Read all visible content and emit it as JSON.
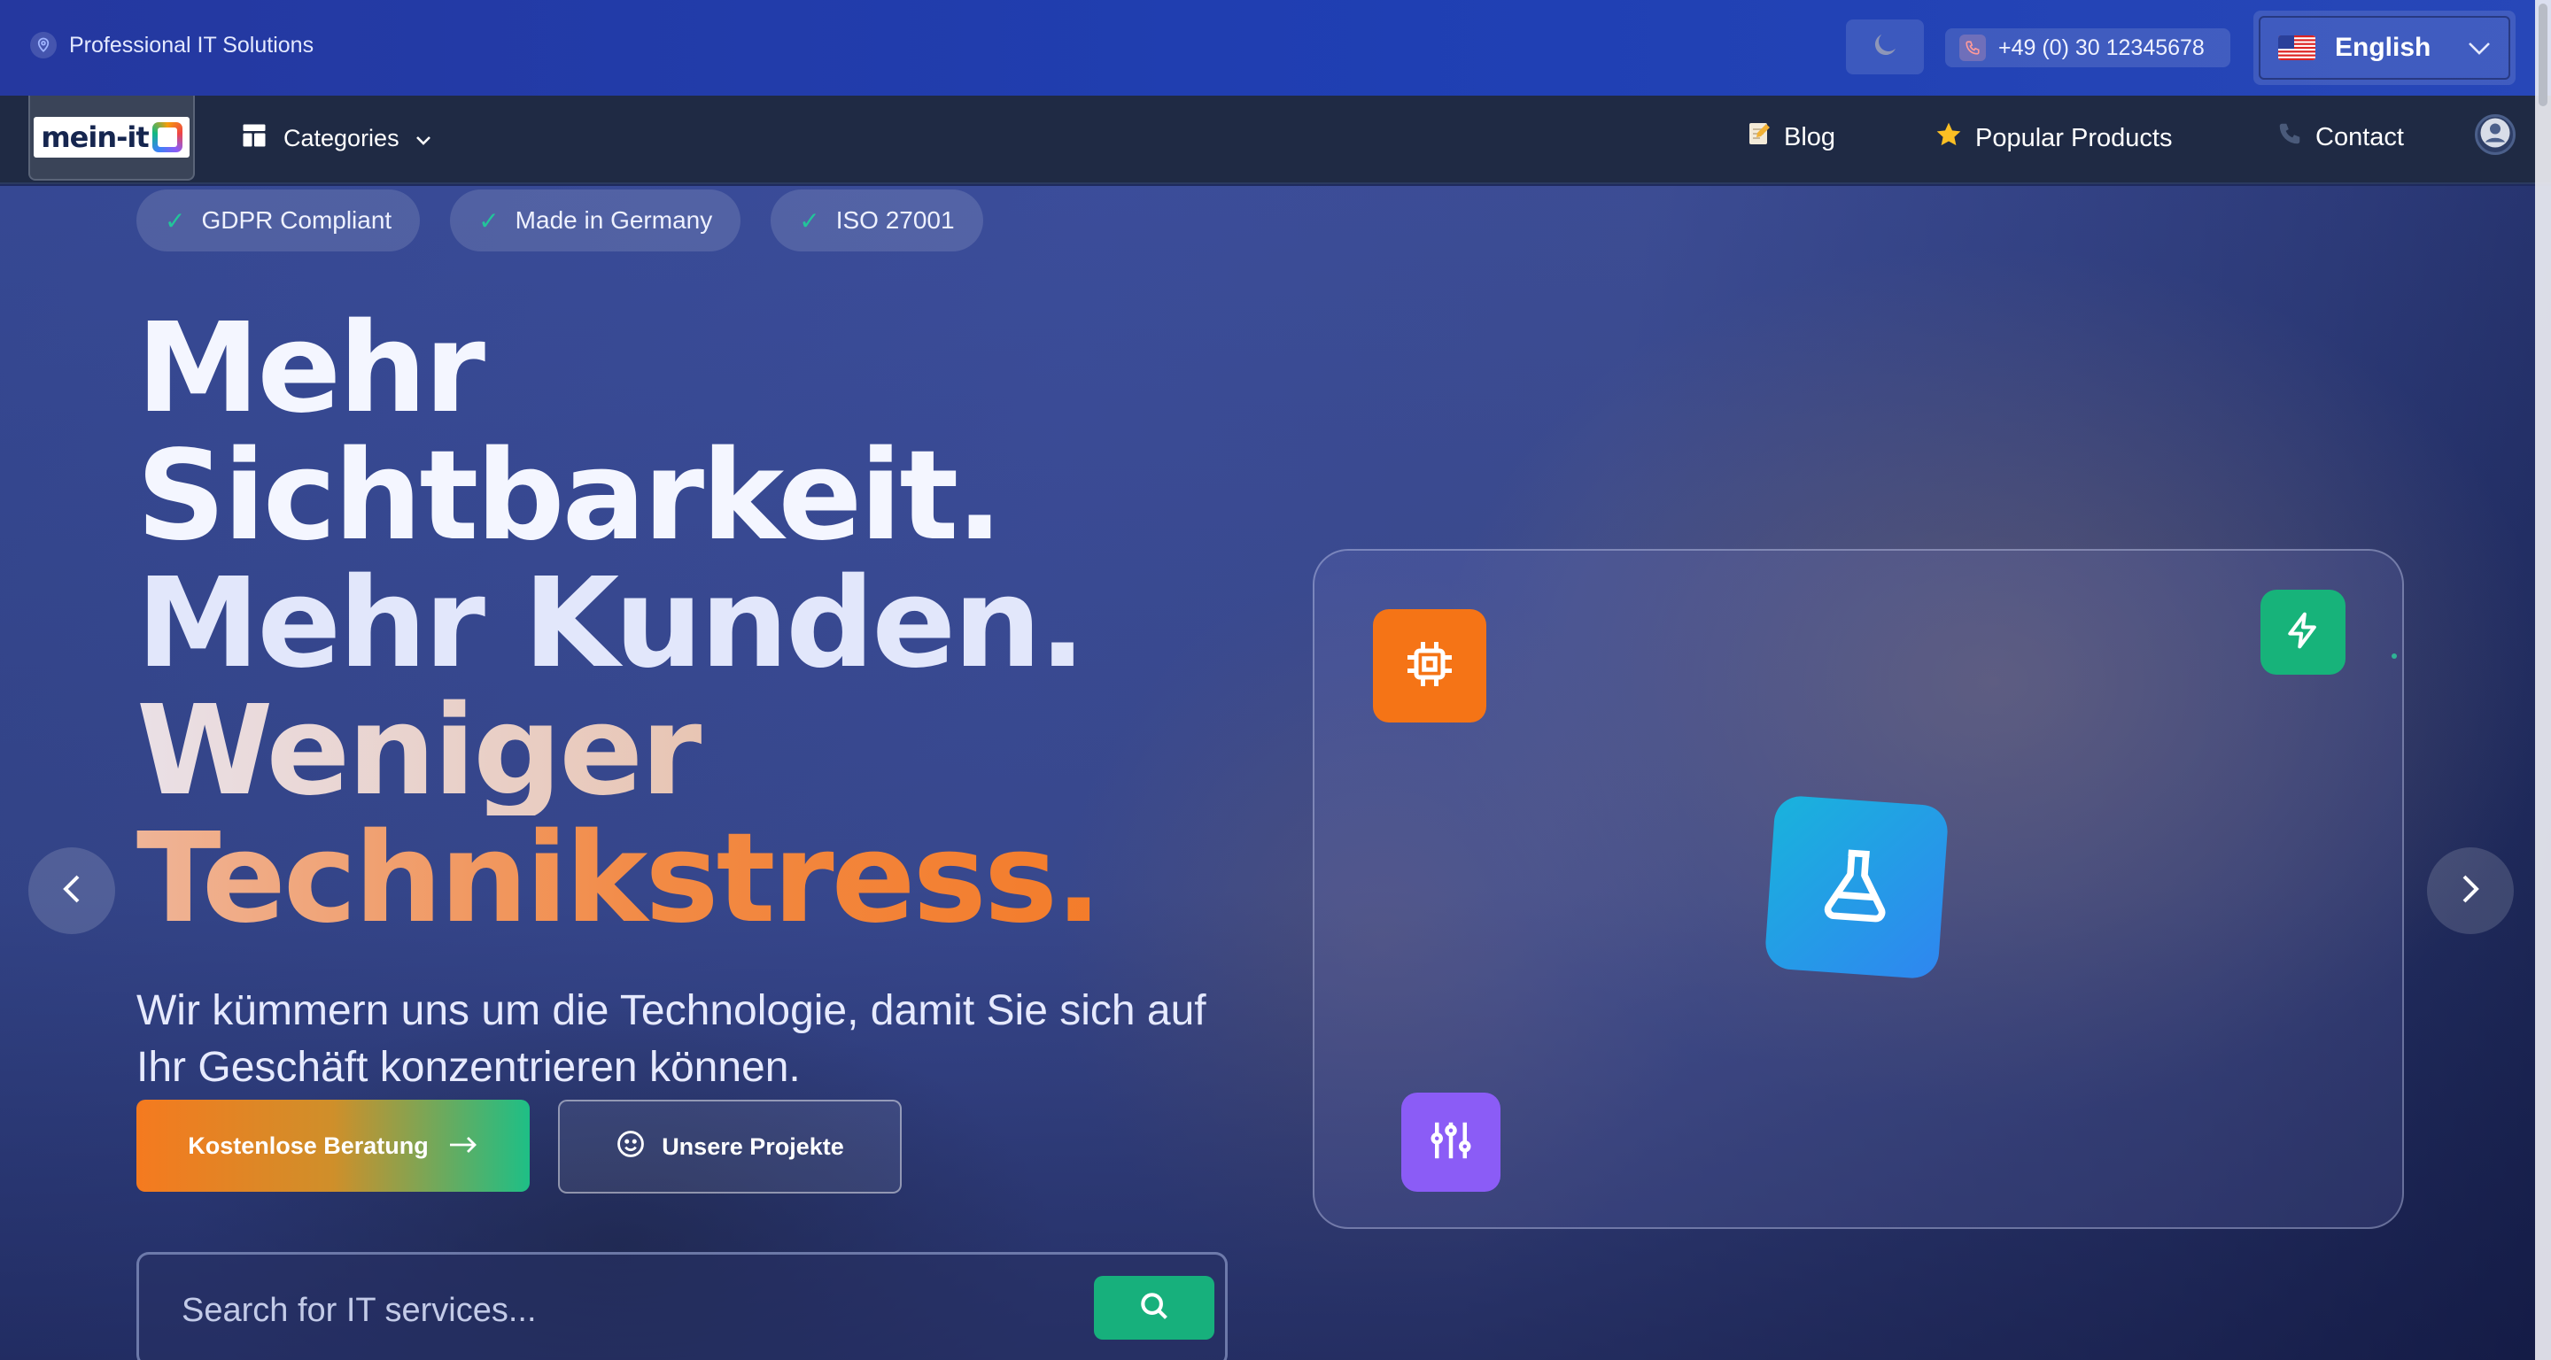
{
  "topbar": {
    "tagline": "Professional IT Solutions",
    "phone": "+49 (0) 30 12345678",
    "language": "English",
    "icons": {
      "tagline": "location-pin-icon",
      "theme": "moon-icon",
      "phone": "phone-icon",
      "flag": "us-flag-icon",
      "dropdown": "chevron-down-icon"
    }
  },
  "nav": {
    "logo_text": "mein-it",
    "categories_label": "Categories",
    "links": [
      {
        "label": "Blog",
        "icon": "memo-icon"
      },
      {
        "label": "Popular Products",
        "icon": "star-icon"
      },
      {
        "label": "Contact",
        "icon": "phone-icon"
      }
    ]
  },
  "hero": {
    "badges": [
      "GDPR Compliant",
      "Made in Germany",
      "ISO 27001"
    ],
    "headline": {
      "line1": "Mehr",
      "line2": "Sichtbarkeit.",
      "line3": "Mehr Kunden.",
      "line4": "Weniger",
      "line5": "Technikstress."
    },
    "subtext": "Wir kümmern uns um die Technologie, damit Sie sich auf Ihr Geschäft konzentrieren können.",
    "primary_button": "Kostenlose Beratung",
    "secondary_button": "Unsere Projekte",
    "search_placeholder": "Search for IT services...",
    "card_icons": [
      "cpu-icon",
      "lightning-icon",
      "flask-icon",
      "sliders-icon"
    ]
  },
  "colors": {
    "topbar": "#1f3fb3",
    "navbar": "#1f2a44",
    "accent_orange": "#f57416",
    "accent_green": "#17b07c",
    "accent_purple": "#8b5cf6",
    "accent_blue": "#2f86f0"
  }
}
